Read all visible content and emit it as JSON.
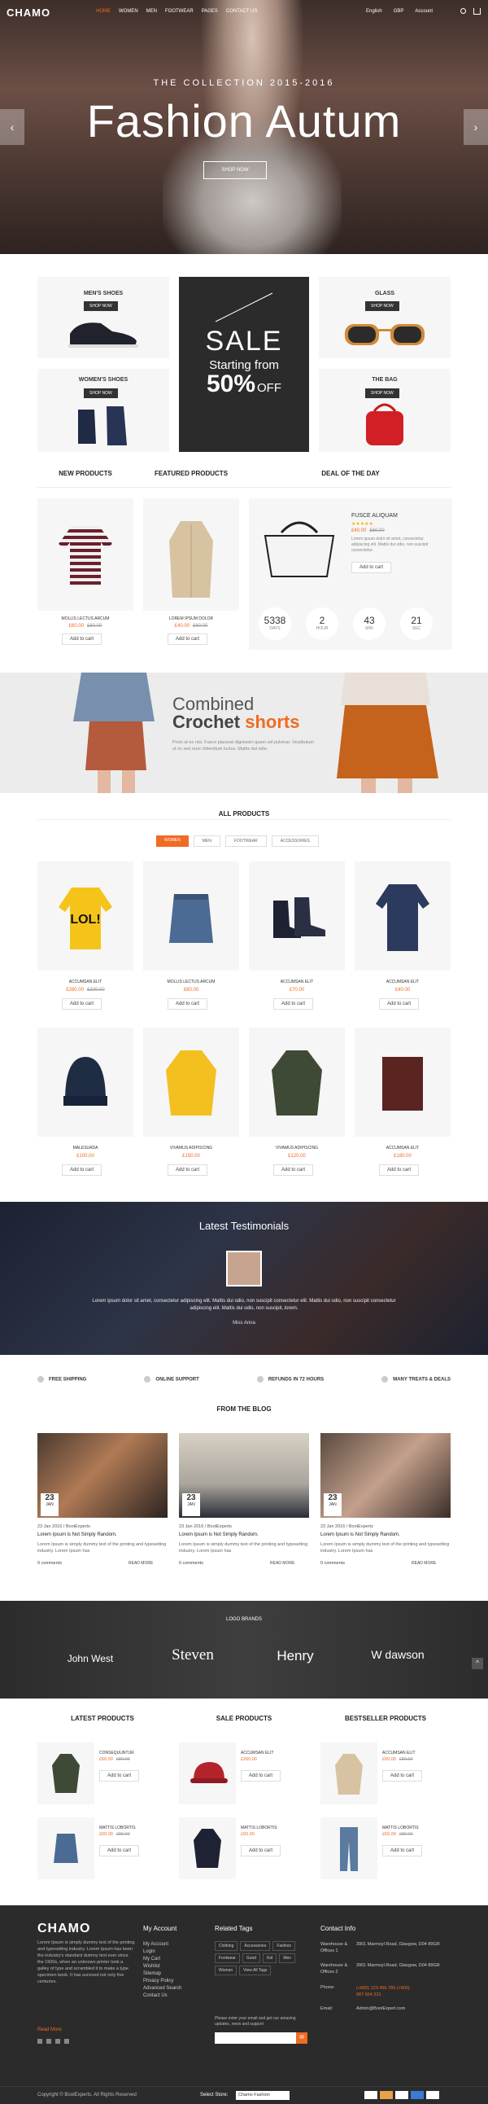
{
  "header": {
    "logo": "CHAMO",
    "nav": [
      "HOME",
      "WOMEN",
      "MEN",
      "FOOTWEAR",
      "PAGES",
      "CONTACT US"
    ],
    "right": [
      "English",
      "GBP",
      "Account"
    ]
  },
  "hero": {
    "subtitle": "THE COLLECTION 2015-2016",
    "title": "Fashion Autum",
    "button": "SHOP NOW"
  },
  "categories": {
    "mens_shoes": {
      "title": "MEN'S SHOES",
      "button": "SHOP NOW"
    },
    "womens_shoes": {
      "title": "WOMEN'S SHOES",
      "button": "SHOP NOW"
    },
    "glass": {
      "title": "GLASS",
      "button": "SHOP NOW"
    },
    "the_bag": {
      "title": "THE BAG",
      "button": "SHOP NOW"
    },
    "sale": {
      "title": "SALE",
      "starting": "Starting from",
      "percent": "50%",
      "off": "OFF"
    }
  },
  "row_titles": {
    "new": "NEW PRODUCTS",
    "featured": "FEATURED PRODUCTS",
    "deal": "DEAL OF THE DAY"
  },
  "new_product": {
    "name": "MOLLIS LECTUS ARCUM",
    "price": "£60.00",
    "old": "£80.00",
    "button": "Add to cart"
  },
  "featured_product": {
    "name": "LOREM IPSUM DOLOR",
    "price": "£40.00",
    "old": "£60.00",
    "button": "Add to cart"
  },
  "deal": {
    "name": "FUSCE ALIQUAM",
    "price": "£40.00",
    "old": "£60.00",
    "desc": "Lorem ipsum dolor sit amet, consectetur adipiscing elit. Mattis dui odio, non suscipit consectetur.",
    "button": "Add to cart",
    "countdown": [
      {
        "value": "5338",
        "label": "DAYS"
      },
      {
        "value": "2",
        "label": "HOUR"
      },
      {
        "value": "43",
        "label": "MIN"
      },
      {
        "value": "21",
        "label": "SEC"
      }
    ]
  },
  "banner": {
    "line1": "Combined",
    "line2a": "Crochet",
    "line2b": "shorts",
    "desc": "Proin at ex nisi. Fusce placerat dignissim quam vel pulvinar. Vestibulum ut ex sed nunc bibendum luctus. Mattis dui odio."
  },
  "all_products": {
    "title": "ALL PRODUCTS",
    "tabs": [
      "WOMEN",
      "MEN",
      "FOOTWEAR",
      "ACCESSORIES"
    ],
    "items": [
      {
        "name": "ACCUMSAN ELIT",
        "price": "£260.00",
        "old": "£320.00",
        "button": "Add to cart"
      },
      {
        "name": "MOLLIS LECTUS ARCUM",
        "price": "£80.00",
        "old": "",
        "button": "Add to cart"
      },
      {
        "name": "ACCUMSAN ELIT",
        "price": "£70.00",
        "old": "",
        "button": "Add to cart"
      },
      {
        "name": "ACCUMSAN ELIT",
        "price": "£40.00",
        "old": "",
        "button": "Add to cart"
      },
      {
        "name": "MALESUADA",
        "price": "£100.00",
        "old": "",
        "button": "Add to cart"
      },
      {
        "name": "VIVAMUS ADIPISCING",
        "price": "£150.00",
        "old": "",
        "button": "Add to cart"
      },
      {
        "name": "VIVAMUS ADIPISCING",
        "price": "£120.00",
        "old": "",
        "button": "Add to cart"
      },
      {
        "name": "ACCUMSAN ELIT",
        "price": "£180.00",
        "old": "",
        "button": "Add to cart"
      }
    ]
  },
  "testimonials": {
    "title": "Latest Testimonials",
    "quote": "Lorem ipsum dolor sit amet, consectetur adipiscing elit. Mattis dui odio, non suscipit consectetur elit. Mattis dui odio, non suscipit consectetur adipiscing elit. Mattis dui odio, non suscipit, lorem.",
    "author": "Miss Anna"
  },
  "services": [
    "FREE SHIPPING",
    "ONLINE SUPPORT",
    "REFUNDS IN 72 HOURS",
    "MANY TREATS & DEALS"
  ],
  "blog": {
    "title": "FROM THE BLOG",
    "posts": [
      {
        "day": "23",
        "month": "JAN",
        "meta": "23 Jan 2016 / BootExperts",
        "title": "Lorem Ipsum is Not Simply Random.",
        "text": "Lorem Ipsum is simply dummy text of the printing and typesetting industry. Lorem Ipsum has",
        "comments": "0 comments",
        "more": "READ MORE"
      },
      {
        "day": "23",
        "month": "JAN",
        "meta": "23 Jan 2016 / BootExperts",
        "title": "Lorem Ipsum is Not Simply Random.",
        "text": "Lorem Ipsum is simply dummy text of the printing and typesetting industry. Lorem Ipsum has",
        "comments": "0 comments",
        "more": "READ MORE"
      },
      {
        "day": "23",
        "month": "JAN",
        "meta": "23 Jan 2016 / BootExperts",
        "title": "Lorem Ipsum is Not Simply Random.",
        "text": "Lorem Ipsum is simply dummy text of the printing and typesetting industry. Lorem Ipsum has",
        "comments": "0 comments",
        "more": "READ MORE"
      }
    ]
  },
  "brands": {
    "title": "LOGO BRANDS",
    "items": [
      "John West",
      "Steven",
      "Henry",
      "W dawson"
    ]
  },
  "bottom_lists": {
    "latest": {
      "title": "LATEST PRODUCTS",
      "items": [
        {
          "name": "CONSEQUUNTUR",
          "price": "£60.00",
          "old": "£80.00",
          "button": "Add to cart"
        },
        {
          "name": "MATTIS LOBORTIS",
          "price": "£60.00",
          "old": "£80.00",
          "button": "Add to cart"
        }
      ]
    },
    "sale": {
      "title": "SALE PRODUCTS",
      "items": [
        {
          "name": "ACCUMSAN ELIT",
          "price": "£260.00",
          "old": "",
          "button": "Add to cart"
        },
        {
          "name": "MATTIS LOBORTIS",
          "price": "£60.00",
          "old": "",
          "button": "Add to cart"
        }
      ]
    },
    "best": {
      "title": "BESTSELLER PRODUCTS",
      "items": [
        {
          "name": "ACCUMSAN ELIT",
          "price": "£60.00",
          "old": "£80.00",
          "button": "Add to cart"
        },
        {
          "name": "MATTIS LOBORTIS",
          "price": "£60.00",
          "old": "£80.00",
          "button": "Add to cart"
        }
      ]
    }
  },
  "footer": {
    "logo": "CHAMO",
    "about": "Lorem Ipsum is simply dummy text of the printing and typesetting industry. Lorem Ipsum has been the industry's standard dummy text ever since the 1500s, when an unknown printer took a galley of type and scrambled it to make a type specimen book. It has survived not only five centuries.",
    "read_more": "Read More",
    "account_title": "My Account",
    "account_links": [
      "My Account",
      "Login",
      "My Cart",
      "Wishlist",
      "Sitemap",
      "Privacy Policy",
      "Advanced Search",
      "Contact Us"
    ],
    "tags_title": "Related Tags",
    "tags": [
      "Clothing",
      "Accessories",
      "Fashion",
      "Footwear",
      "Good",
      "Kid",
      "Men",
      "Women",
      "View All Tags"
    ],
    "newsletter_text": "Please enter your email and get our amazing updates, news and support",
    "contact_title": "Contact Info",
    "contact": [
      {
        "label": "Warehouse & Offices 1",
        "value": "3901 Marmoyl Road, Glasgow, D04 89GR"
      },
      {
        "label": "Warehouse & Offices 2",
        "value": "3901 Marmoyl Road, Glasgow, D04 89GR"
      },
      {
        "label": "Phone:",
        "value": "(+800) 123 456 789 (+800) 987 654 321"
      },
      {
        "label": "Email:",
        "value": "Admin@BootExpert.com"
      }
    ],
    "copyright": "Copyright © BootExperts. All Rights Reserved",
    "select_store": "Select Store:",
    "store_value": "Chamo Fashion"
  }
}
